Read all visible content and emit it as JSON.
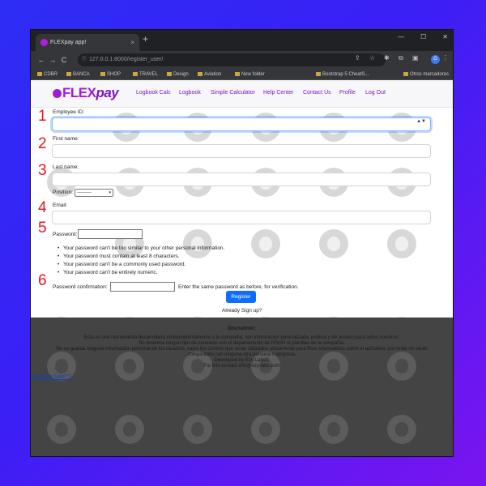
{
  "browser": {
    "tab_title": "FLEXpay app!",
    "tab_close": "×",
    "new_tab": "+",
    "window_controls": [
      "—",
      "☐",
      "✕"
    ],
    "url": "127.0.0.1:8000/register_user/",
    "nav": {
      "back": "←",
      "forward": "→",
      "reload": "C"
    },
    "profile_initial": "G",
    "bookmarks": [
      "CDBR",
      "BANCA",
      "SHOP",
      "TRAVEL",
      "Design",
      "Aviation",
      "New folder",
      "Bootstrap 5 CheatS...",
      "Otros marcadores"
    ]
  },
  "site": {
    "logo_flex": "FLEX",
    "logo_pay": "pay",
    "nav_links": [
      "Logbook Calc",
      "Logbook",
      "Simple Calculator",
      "Help Center",
      "Contact Us",
      "Profile",
      "Log Out"
    ]
  },
  "form": {
    "employee_id_label": "Employee ID:",
    "stepper": "▲▼",
    "first_name_label": "First name:",
    "last_name_label": "Last name:",
    "position_label": "Position:",
    "position_value": "---------",
    "position_caret": "▾",
    "email_label": "Email:",
    "password_label": "Password:",
    "password_hints": [
      "Your password can't be too similar to your other personal information.",
      "Your password must contain at least 8 characters.",
      "Your password can't be a commonly used password.",
      "Your password can't be entirely numeric."
    ],
    "password_confirm_label": "Password confirmation:",
    "password_confirm_help": "Enter the same password as before, for verification.",
    "register_button": "Register",
    "signin_text": "Already Sign up?"
  },
  "footer": {
    "disclaimer_title": "Disclaimer:",
    "disclaimer_lines": [
      "Esta es una herramienta desarrollada independientemente a la compañia, con informacion generalizada, publica y de acceso para todos nosotros.",
      "No tenemos ningun tipo de conexion con el departamento de RRHH ni planillas de la compañia.",
      "No se guarda ninguna informacion personal de los usuarios, salvo los correos que seran utilizados unicamente para fines informativos sobre el aplicativo, por ende no seran",
      "compartidos con ninguna otra persona o empresa.",
      "Developed by Ezy-Labs©",
      "For info contact info@ezy-labs.com"
    ],
    "link": "Padrino Sale??"
  },
  "annotations": [
    "1",
    "2",
    "3",
    "4",
    "5",
    "6"
  ],
  "colors": {
    "brand": "#a31ad6",
    "brand_dark": "#7f12c3",
    "primary_button": "#0d6efd",
    "annotation": "#e8141e"
  }
}
